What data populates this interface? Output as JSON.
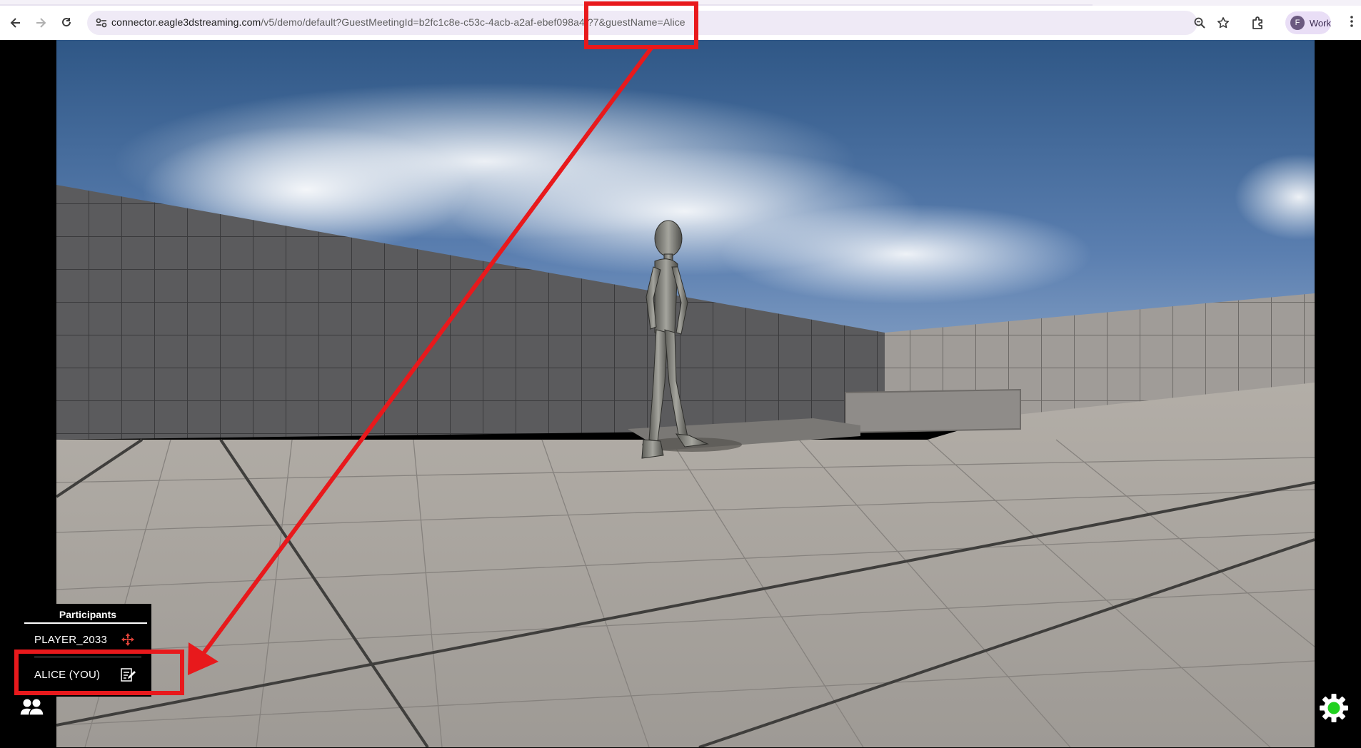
{
  "browser": {
    "url_host": "connector.eagle3dstreaming.com",
    "url_path": "/v5/demo/default?GuestMeetingId=b2fc1c8e-c53c-4acb-a2af-ebef098a4f?7&guestName=Alice",
    "profile_initial": "F",
    "profile_label": "Work",
    "icons": [
      "back-icon",
      "forward-icon",
      "reload-icon",
      "site-info-icon",
      "zoom-icon",
      "bookmark-star-icon",
      "extensions-icon",
      "more-menu-icon"
    ]
  },
  "participants_panel": {
    "title": "Participants",
    "items": [
      {
        "name": "PLAYER_2033",
        "icon": "control-transfer-icon"
      },
      {
        "name": "ALICE  (YOU)",
        "icon": "edit-name-icon"
      }
    ]
  },
  "controls": {
    "participants_toggle_icon": "participants-icon",
    "settings_icon": "settings-gear-icon",
    "status_color": "#21d11f"
  },
  "annotation": {
    "color": "#e8191c"
  }
}
